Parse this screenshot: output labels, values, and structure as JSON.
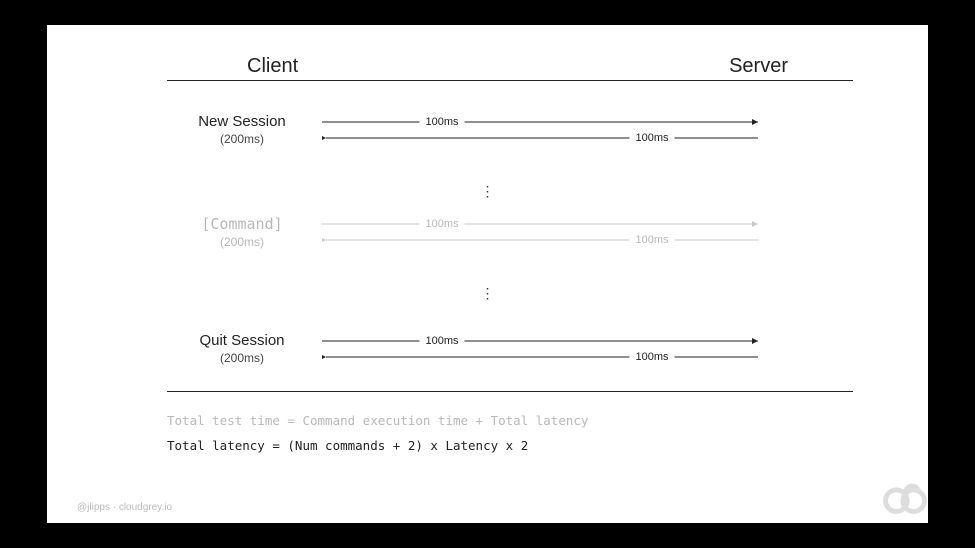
{
  "header": {
    "client": "Client",
    "server": "Server"
  },
  "rows": {
    "newSession": {
      "label": "New Session",
      "sub": "(200ms)",
      "req": "100ms",
      "res": "100ms"
    },
    "command": {
      "label": "[Command]",
      "sub": "(200ms)",
      "req": "100ms",
      "res": "100ms"
    },
    "quitSession": {
      "label": "Quit Session",
      "sub": "(200ms)",
      "req": "100ms",
      "res": "100ms"
    }
  },
  "formulas": {
    "totalTestTime": "Total test time = Command execution time + Total latency",
    "totalLatency": "Total latency = (Num commands + 2) x Latency x 2"
  },
  "credit": "@jlipps · cloudgrey.io",
  "colors": {
    "primary": "#222222",
    "faded": "#b8b8b8"
  },
  "latencyPerDirection": "100ms",
  "roundTripLatency": "200ms"
}
